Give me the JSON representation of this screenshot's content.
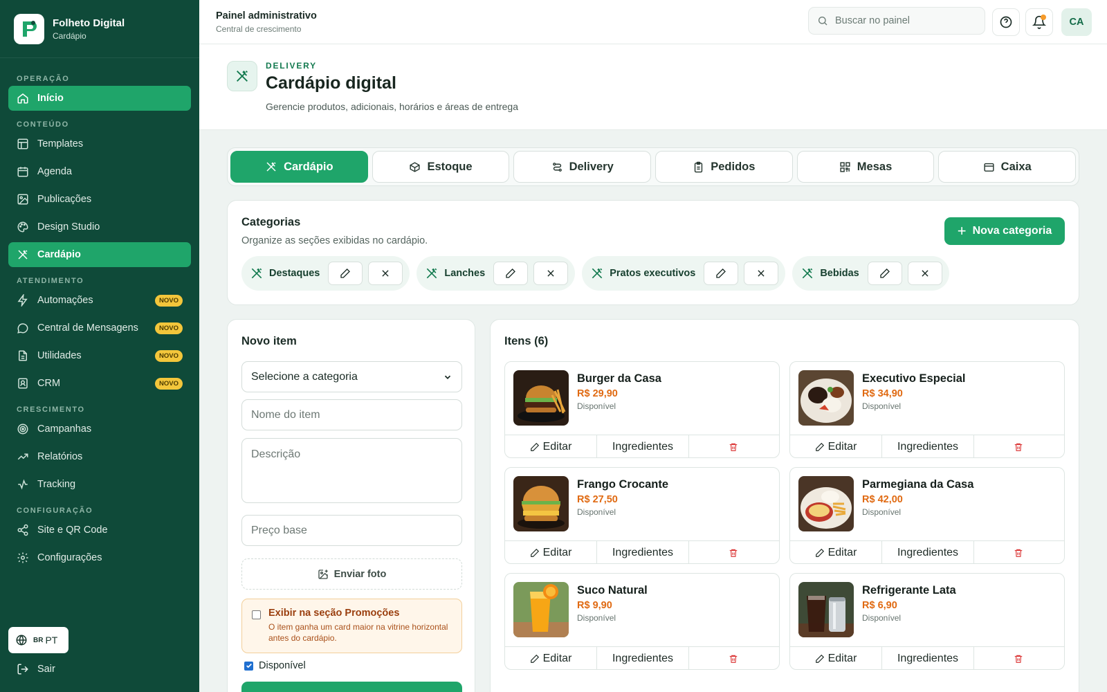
{
  "brand": {
    "title": "Folheto Digital",
    "subtitle": "Cardápio"
  },
  "sidebar": {
    "sections": {
      "operacao": "OPERAÇÃO",
      "conteudo": "CONTEÚDO",
      "atendimento": "ATENDIMENTO",
      "crescimento": "CRESCIMENTO",
      "configuracao": "CONFIGURAÇÃO"
    },
    "items": {
      "inicio": "Início",
      "templates": "Templates",
      "agenda": "Agenda",
      "publicacoes": "Publicações",
      "design_studio": "Design Studio",
      "cardapio": "Cardápio",
      "automacoes": "Automações",
      "central_mensagens": "Central de Mensagens",
      "utilidades": "Utilidades",
      "crm": "CRM",
      "campanhas": "Campanhas",
      "relatorios": "Relatórios",
      "tracking": "Tracking",
      "site_qr": "Site e QR Code",
      "configuracoes": "Configurações"
    },
    "badge_novo": "NOVO",
    "lang_flag": "BR",
    "lang": "PT",
    "logout": "Sair"
  },
  "topbar": {
    "title": "Painel administrativo",
    "subtitle": "Central de crescimento",
    "search_placeholder": "Buscar no painel",
    "avatar": "CA"
  },
  "header": {
    "eyebrow": "DELIVERY",
    "title": "Cardápio digital",
    "description": "Gerencie produtos, adicionais, horários e áreas de entrega"
  },
  "tabs": [
    "Cardápio",
    "Estoque",
    "Delivery",
    "Pedidos",
    "Mesas",
    "Caixa"
  ],
  "categories": {
    "title": "Categorias",
    "subtitle": "Organize as seções exibidas no cardápio.",
    "new_button": "Nova categoria",
    "chips": [
      "Destaques",
      "Lanches",
      "Pratos executivos",
      "Bebidas"
    ]
  },
  "new_item": {
    "title": "Novo item",
    "category_select": "Selecione a categoria",
    "name_placeholder": "Nome do item",
    "description_placeholder": "Descrição",
    "price_placeholder": "Preço base",
    "upload_label": "Enviar foto",
    "promo_title": "Exibir na seção Promoções",
    "promo_text": "O item ganha um card maior na vitrine horizontal antes do cardápio.",
    "available_label": "Disponível"
  },
  "items": {
    "title": "Itens (6)",
    "edit_label": "Editar",
    "ingredients_label": "Ingredientes",
    "list": [
      {
        "name": "Burger da Casa",
        "price": "R$ 29,90",
        "status": "Disponível"
      },
      {
        "name": "Executivo Especial",
        "price": "R$ 34,90",
        "status": "Disponível"
      },
      {
        "name": "Frango Crocante",
        "price": "R$ 27,50",
        "status": "Disponível"
      },
      {
        "name": "Parmegiana da Casa",
        "price": "R$ 42,00",
        "status": "Disponível"
      },
      {
        "name": "Suco Natural",
        "price": "R$ 9,90",
        "status": "Disponível"
      },
      {
        "name": "Refrigerante Lata",
        "price": "R$ 6,90",
        "status": "Disponível"
      }
    ]
  },
  "colors": {
    "sidebar_bg": "#0f4a39",
    "accent": "#1fa56a",
    "price": "#e06a12",
    "badge": "#f3c63b"
  }
}
